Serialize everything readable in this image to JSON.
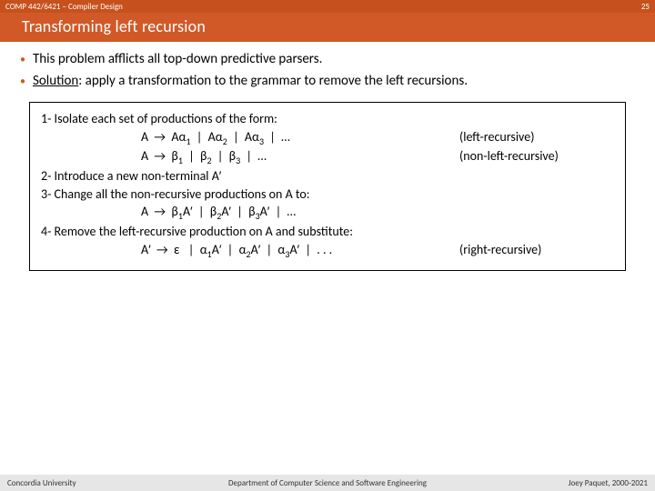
{
  "header": {
    "course": "COMP 442/6421 – Compiler Design",
    "page_number": "25"
  },
  "title": "Transforming left recursion",
  "bullets": {
    "b1": "This problem afflicts all top-down predictive parsers.",
    "b2_label": "Solution",
    "b2_rest": ": apply a transformation to the grammar to remove the left recursions."
  },
  "algo": {
    "l1": "1- Isolate each set of productions of the form:",
    "l2a": "A  →  Aα",
    "l2b": "  |  Aα",
    "l2c": "  |  Aα",
    "l2d": "  |  …",
    "l2note": "(left-recursive)",
    "l3a": "A  →  β",
    "l3b": "  |  β",
    "l3c": "  |  β",
    "l3d": "  |  …",
    "l3note": "(non-left-recursive)",
    "l4": "2- Introduce a new non-terminal A′",
    "l5": "3- Change all the non-recursive productions on A to:",
    "l6a": "A  →  β",
    "l6b": "A′  |  β",
    "l6c": "A′  |  β",
    "l6d": "A′  |  …",
    "l7": "4- Remove the left-recursive production on A and substitute:",
    "l8a": "A′  →  ε   |  α",
    "l8b": "A′  |  α",
    "l8c": "A′  |  α",
    "l8d": "A′  |  . . .",
    "l8note": "(right-recursive)",
    "s1": "1",
    "s2": "2",
    "s3": "3"
  },
  "footer": {
    "left": "Concordia University",
    "center": "Department of Computer Science and Software Engineering",
    "right": "Joey Paquet, 2000-2021"
  }
}
